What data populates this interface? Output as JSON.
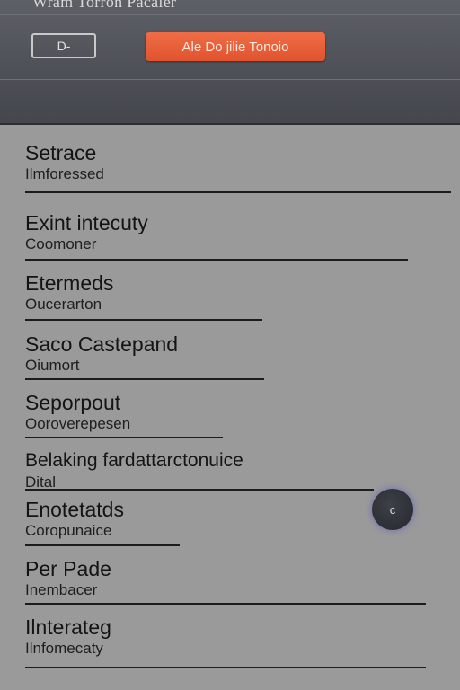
{
  "header": {
    "title": "Wram Torron Pacaler",
    "back_button": "D-",
    "primary_button": "Ale Do jilie Tonoio"
  },
  "items": [
    {
      "label": "Setrace",
      "sub": "Ilmforessed"
    },
    {
      "label": "Exint intecuty",
      "sub": "Coomoner"
    },
    {
      "label": "Etermeds",
      "sub": "Oucerarton"
    },
    {
      "label": "Saco Castepand",
      "sub": "Oiumort"
    },
    {
      "label": "Seporpout",
      "sub": "Ooroverepesen"
    },
    {
      "label": "Belaking fardattarctonuice",
      "sub": "Dital"
    },
    {
      "label": "Enotetatds",
      "sub": "Coropunaice"
    },
    {
      "label": "Per Pade",
      "sub": "Inembacer"
    },
    {
      "label": "Ilnterateg",
      "sub": "Ilnfomecaty"
    }
  ],
  "fab": {
    "label": "c",
    "icon": "circle-button-icon"
  },
  "colors": {
    "accent": "#e65c36",
    "header_bg": "#505359",
    "body_bg": "#9a9a9a"
  }
}
